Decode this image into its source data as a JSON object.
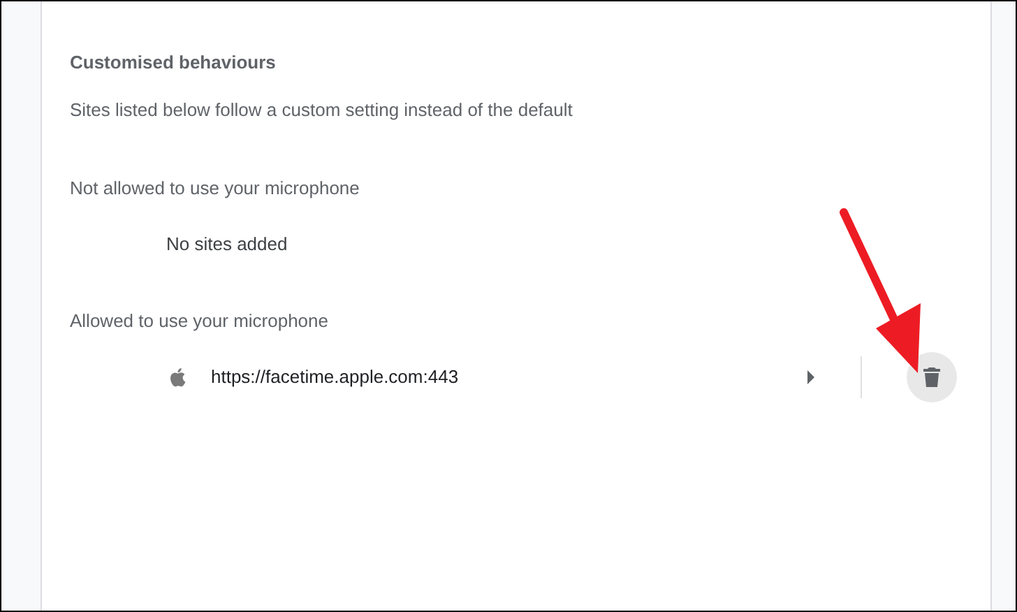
{
  "heading": "Customised behaviours",
  "description": "Sites listed below follow a custom setting instead of the default",
  "sections": [
    {
      "title": "Not allowed to use your microphone",
      "items": [
        {
          "kind": "empty",
          "text": "No sites added"
        }
      ]
    },
    {
      "title": "Allowed to use your microphone",
      "items": [
        {
          "kind": "site",
          "url": "https://facetime.apple.com:443"
        }
      ]
    }
  ]
}
